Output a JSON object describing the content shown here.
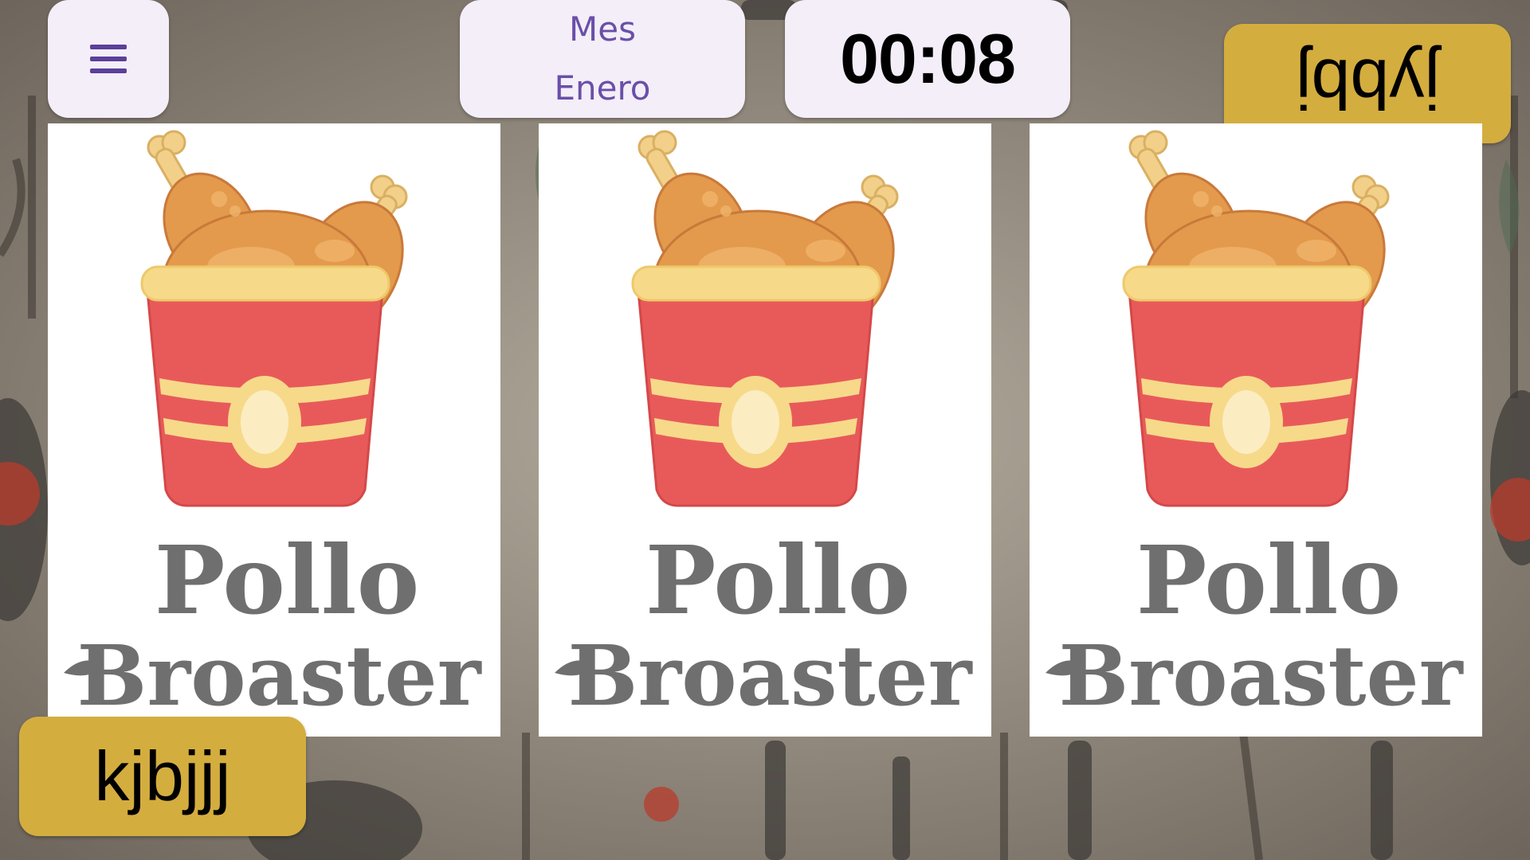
{
  "top_bar": {
    "month_label": "Mes",
    "month_value": "Enero",
    "timer": "00:08"
  },
  "player_top_button": "jybbj",
  "player_bottom_button": "kjbjjj",
  "cards": [
    {
      "line1": "Pollo",
      "line2": "Broaster"
    },
    {
      "line1": "Pollo",
      "line2": "Broaster"
    },
    {
      "line1": "Pollo",
      "line2": "Broaster"
    }
  ],
  "colors": {
    "accent": "#6a4fa8",
    "gold": "#d4ad3f",
    "pill_bg": "#f3eef8",
    "bucket_red": "#e85a5a",
    "chicken": "#e39a4c"
  },
  "icons": [
    "menu-icon",
    "chicken-bucket-icon"
  ]
}
